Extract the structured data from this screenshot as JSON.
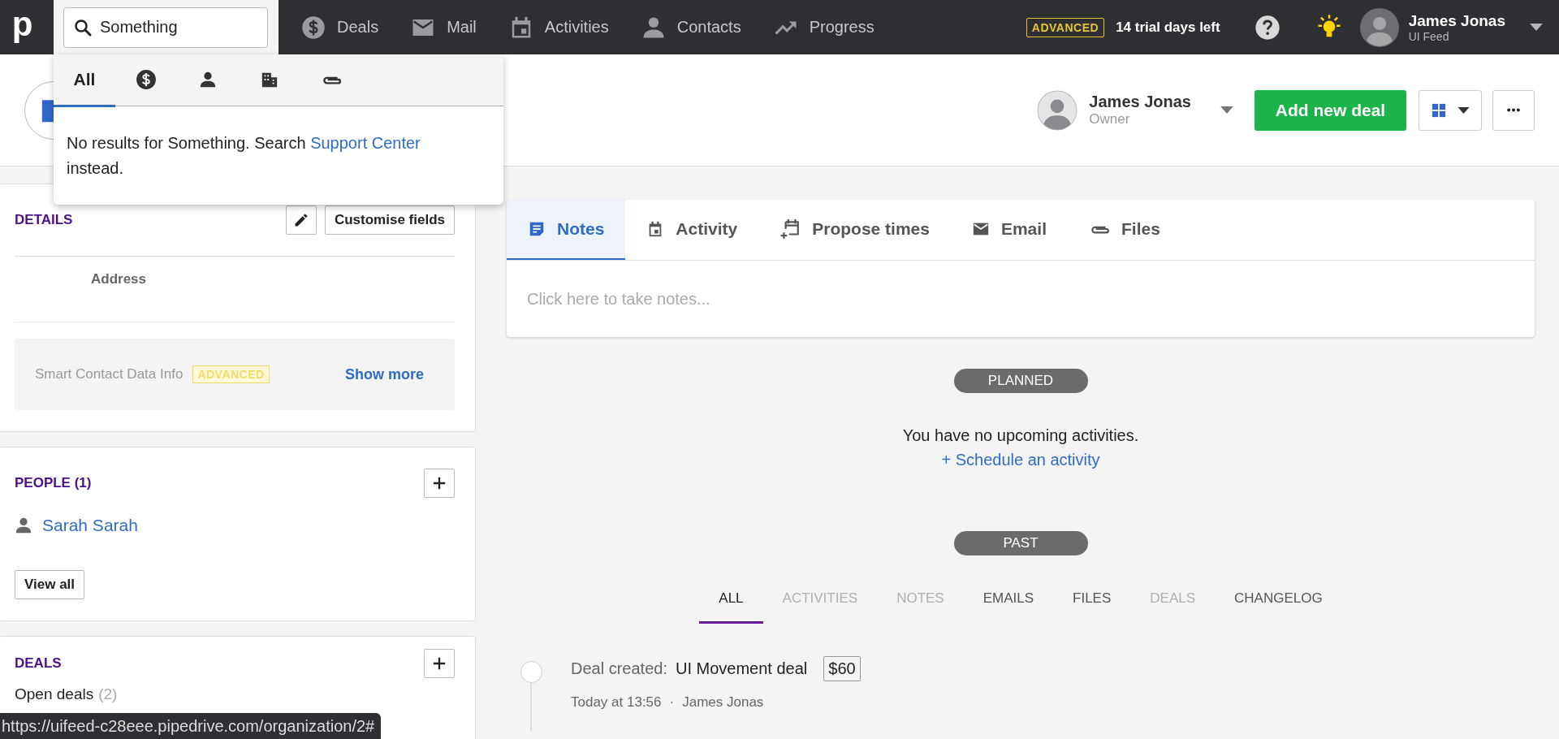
{
  "topbar": {
    "logo": "p",
    "search": {
      "value": "Something"
    },
    "nav": [
      {
        "label": "Deals"
      },
      {
        "label": "Mail"
      },
      {
        "label": "Activities"
      },
      {
        "label": "Contacts"
      },
      {
        "label": "Progress"
      }
    ],
    "plan_badge": "ADVANCED",
    "trial": "14 trial days left",
    "user": {
      "name": "James Jonas",
      "company": "UI Feed"
    }
  },
  "search_dropdown": {
    "tabs": [
      {
        "kind": "text",
        "label": "All",
        "selected": true
      },
      {
        "kind": "deal",
        "selected": false
      },
      {
        "kind": "person",
        "selected": false
      },
      {
        "kind": "organization",
        "selected": false
      },
      {
        "kind": "file",
        "selected": false
      }
    ],
    "message": "No results for Something. Search ",
    "link": "Support Center",
    "message_end": " instead."
  },
  "header": {
    "owner": {
      "name": "James Jonas",
      "role": "Owner"
    },
    "add_button": "Add new deal"
  },
  "details": {
    "title": "DETAILS",
    "customise": "Customise fields",
    "field_label": "Address",
    "smart_info": "Smart Contact Data Info",
    "smart_badge": "ADVANCED",
    "show_more": "Show more"
  },
  "people": {
    "title": "PEOPLE (1)",
    "items": [
      {
        "name": "Sarah Sarah"
      }
    ],
    "view_all": "View all"
  },
  "deals": {
    "title": "DEALS",
    "open_label": "Open deals",
    "open_count": "(2)"
  },
  "composer": {
    "tabs": [
      {
        "kind": "notes",
        "label": "Notes",
        "selected": true
      },
      {
        "kind": "activity",
        "label": "Activity",
        "selected": false
      },
      {
        "kind": "propose",
        "label": "Propose times",
        "selected": false
      },
      {
        "kind": "email",
        "label": "Email",
        "selected": false
      },
      {
        "kind": "files",
        "label": "Files",
        "selected": false
      }
    ],
    "placeholder": "Click here to take notes..."
  },
  "planned": {
    "pill": "PLANNED",
    "empty": "You have no upcoming activities.",
    "schedule": "+ Schedule an activity"
  },
  "past": {
    "pill": "PAST",
    "filters": [
      {
        "label": "ALL",
        "selected": true,
        "disabled": false
      },
      {
        "label": "ACTIVITIES",
        "selected": false,
        "disabled": true
      },
      {
        "label": "NOTES",
        "selected": false,
        "disabled": true
      },
      {
        "label": "EMAILS",
        "selected": false,
        "disabled": false
      },
      {
        "label": "FILES",
        "selected": false,
        "disabled": false
      },
      {
        "label": "DEALS",
        "selected": false,
        "disabled": true
      },
      {
        "label": "CHANGELOG",
        "selected": false,
        "disabled": false
      }
    ],
    "items": [
      {
        "action": "Deal created:",
        "title": "UI Movement deal",
        "amount": "$60",
        "time": "Today at 13:56",
        "separator": "·",
        "user": "James Jonas"
      }
    ]
  },
  "status_url": "https://uifeed-c28eee.pipedrive.com/organization/2#"
}
